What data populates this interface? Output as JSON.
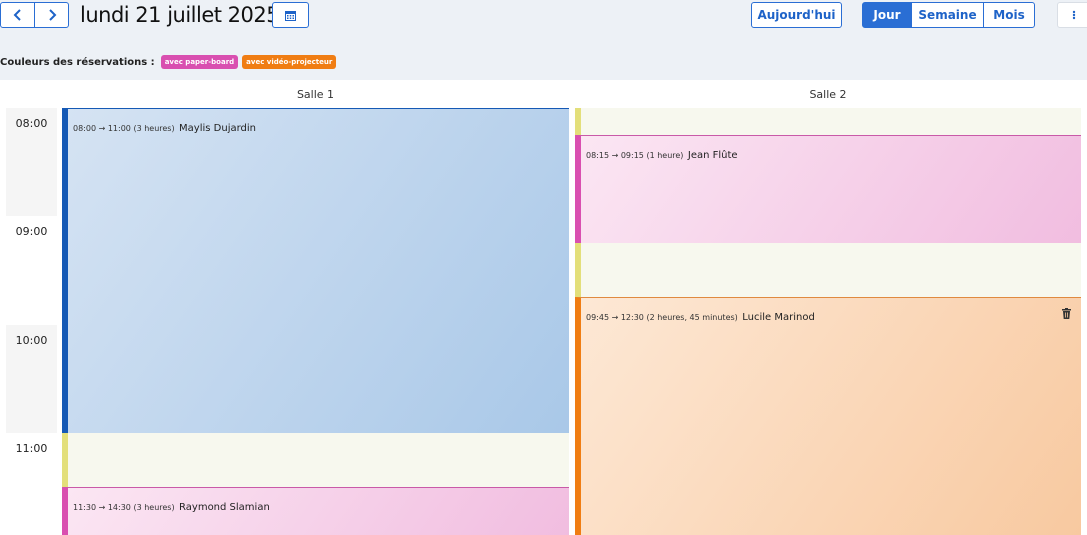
{
  "toolbar": {
    "prev_icon": "chevron-left-icon",
    "next_icon": "chevron-right-icon",
    "date_title": "lundi 21 juillet 2025",
    "calendar_icon": "calendar-icon",
    "today_label": "Aujourd'hui",
    "views": [
      {
        "label": "Jour",
        "active": true
      },
      {
        "label": "Semaine",
        "active": false
      },
      {
        "label": "Mois",
        "active": false
      }
    ],
    "more_icon": "more-vertical-icon"
  },
  "legend": {
    "label": "Couleurs des réservations :",
    "tags": [
      {
        "label": "avec paper-board",
        "color": "#d94fb0"
      },
      {
        "label": "avec vidéo-projecteur",
        "color": "#f07d13"
      }
    ]
  },
  "rooms": [
    "Salle 1",
    "Salle 2"
  ],
  "hours": [
    "08:00",
    "09:00",
    "10:00",
    "11:00"
  ],
  "events": {
    "e1": {
      "time": "08:00 → 11:00 (3 heures)",
      "name": "Maylis Dujardin"
    },
    "e2": {
      "time": "11:30 → 14:30 (3 heures)",
      "name": "Raymond Slamian"
    },
    "e3": {
      "time": "08:15 → 09:15 (1 heure)",
      "name": "Jean Flûte"
    },
    "e4": {
      "time": "09:45 → 12:30 (2 heures, 45 minutes)",
      "name": "Lucile Marinod",
      "icon": "trash-icon"
    }
  },
  "colors": {
    "accent": "#2a6ed4",
    "booking_default": "#1559b5",
    "paper_board": "#d94fb0",
    "video_projector": "#f07d13",
    "free_slot": "#e3df7a"
  }
}
